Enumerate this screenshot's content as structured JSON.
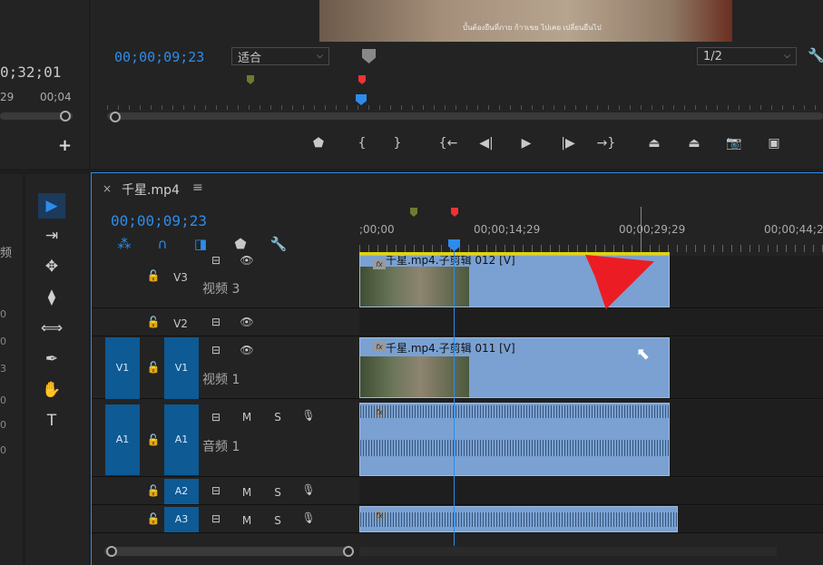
{
  "monitor": {
    "subtitle": "บั้นต้องยืนที่ภาย ก้าวเขย ไปเคย เปลี่ยนยืนไป",
    "timecode": "00;00;09;23",
    "fit_label": "适合",
    "resolution_label": "1/2",
    "transport": {
      "add_marker": "⬟",
      "mark_in": "{",
      "mark_out": "}",
      "go_to_in": "{←",
      "step_back": "◀|",
      "play": "▶",
      "step_forward": "|▶",
      "go_to_out": "→}",
      "lift": "⏏",
      "extract": "⏏",
      "export_frame": "📷",
      "compare": "▣"
    }
  },
  "left_panel": {
    "timecode": "0;32;01",
    "time_a": "29",
    "time_b": "00;04",
    "label": "频",
    "numbers": [
      "0",
      "0",
      "3",
      "0",
      "0",
      "0"
    ]
  },
  "tools": [
    "▶",
    "⇥",
    "✥",
    "⧫",
    "⟺",
    "✒",
    "✋",
    "T"
  ],
  "timeline": {
    "title": "千星.mp4",
    "timecode": "00;00;09;23",
    "ruler_labels": [
      ";00;00",
      "00;00;14;29",
      "00;00;29;29",
      "00;00;44;2"
    ],
    "tool_icons": [
      "⁂",
      "∩",
      "◨",
      "⬟",
      "🔧"
    ],
    "tracks": {
      "v3": {
        "label": "V3",
        "name": "视频 3"
      },
      "v2": {
        "label": "V2"
      },
      "v1": {
        "source": "V1",
        "label": "V1",
        "name": "视频 1"
      },
      "a1": {
        "source": "A1",
        "label": "A1",
        "name": "音频 1"
      },
      "a2": {
        "label": "A2"
      },
      "a3": {
        "label": "A3"
      }
    },
    "audio_buttons": {
      "mute": "M",
      "solo": "S"
    },
    "clips": {
      "v3": {
        "label": "千星.mp4.子剪辑 012 [V]"
      },
      "v1": {
        "label": "千星.mp4.子剪辑 011 [V]"
      },
      "fx": "fx"
    }
  },
  "colors": {
    "accent": "#2d8ceb",
    "clip": "#7aa1d2",
    "target": "#0d5a94",
    "arrow": "#ec1c24"
  }
}
